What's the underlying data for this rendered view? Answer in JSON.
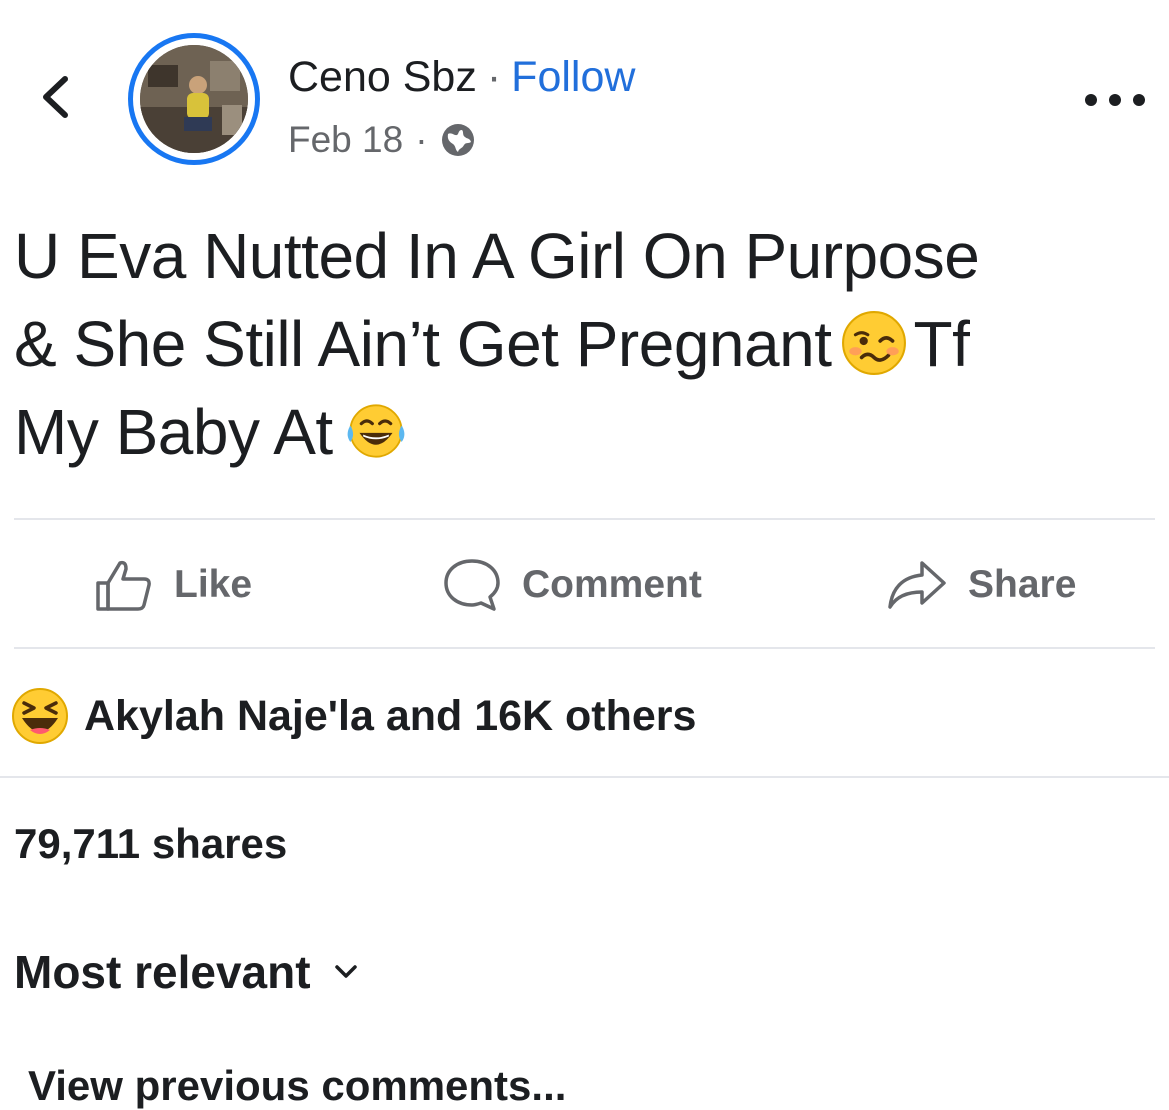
{
  "header": {
    "author": "Ceno Sbz",
    "separator": "·",
    "follow_label": "Follow",
    "date": "Feb 18",
    "audience_icon": "globe-icon"
  },
  "post": {
    "line1": "U Eva Nutted In A Girl On Purpose",
    "line2a": "& She Still Ain’t Get Pregnant",
    "line2b": "Tf",
    "line3": "My Baby At",
    "emoji1": "woozy-face-emoji",
    "emoji2": "face-with-tears-of-joy-emoji"
  },
  "actions": {
    "like": "Like",
    "comment": "Comment",
    "share": "Share"
  },
  "reactions": {
    "icon": "haha-reaction-icon",
    "text": "Akylah Naje'la and 16K others"
  },
  "stats": {
    "shares": "79,711 shares"
  },
  "comments": {
    "sort_label": "Most relevant",
    "view_previous": "View previous comments..."
  },
  "colors": {
    "accent": "#1877f2",
    "follow": "#216fdb",
    "text": "#1c1e21",
    "secondary": "#65676b",
    "divider": "#e4e6eb",
    "emoji_yellow": "#ffcc33"
  }
}
